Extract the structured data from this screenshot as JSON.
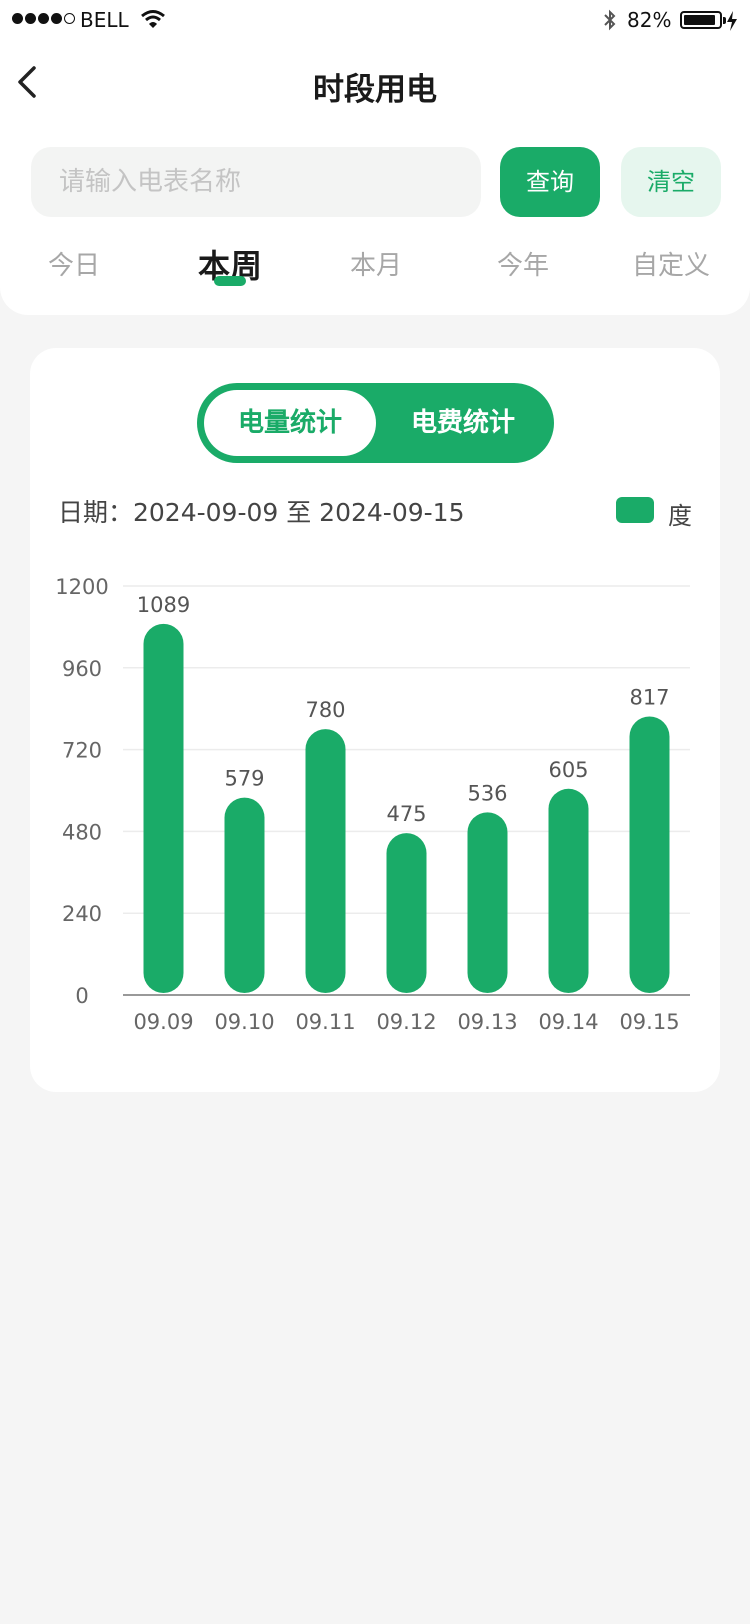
{
  "status_bar": {
    "carrier": "BELL",
    "battery": "82%"
  },
  "header": {
    "title": "时段用电"
  },
  "search": {
    "placeholder": "请输入电表名称",
    "query_label": "查询",
    "clear_label": "清空"
  },
  "tabs": [
    {
      "label": "今日",
      "active": false
    },
    {
      "label": "本周",
      "active": true
    },
    {
      "label": "本月",
      "active": false
    },
    {
      "label": "今年",
      "active": false
    },
    {
      "label": "自定义",
      "active": false
    }
  ],
  "segment": {
    "options": [
      "电量统计",
      "电费统计"
    ],
    "selected": "电量统计"
  },
  "date_range": "日期：2024-09-09 至 2024-09-15",
  "colors": {
    "accent": "#1aab68",
    "accent_light": "#e6f6ee"
  },
  "chart_data": {
    "type": "bar",
    "categories": [
      "09.09",
      "09.10",
      "09.11",
      "09.12",
      "09.13",
      "09.14",
      "09.15"
    ],
    "series": [
      {
        "name": "度",
        "values": [
          1089,
          579,
          780,
          475,
          536,
          605,
          817
        ]
      }
    ],
    "yticks": [
      0,
      240,
      480,
      720,
      960,
      1200
    ],
    "ylim": [
      0,
      1200
    ],
    "grid": true,
    "legend": "top-right",
    "data_labels": true
  }
}
